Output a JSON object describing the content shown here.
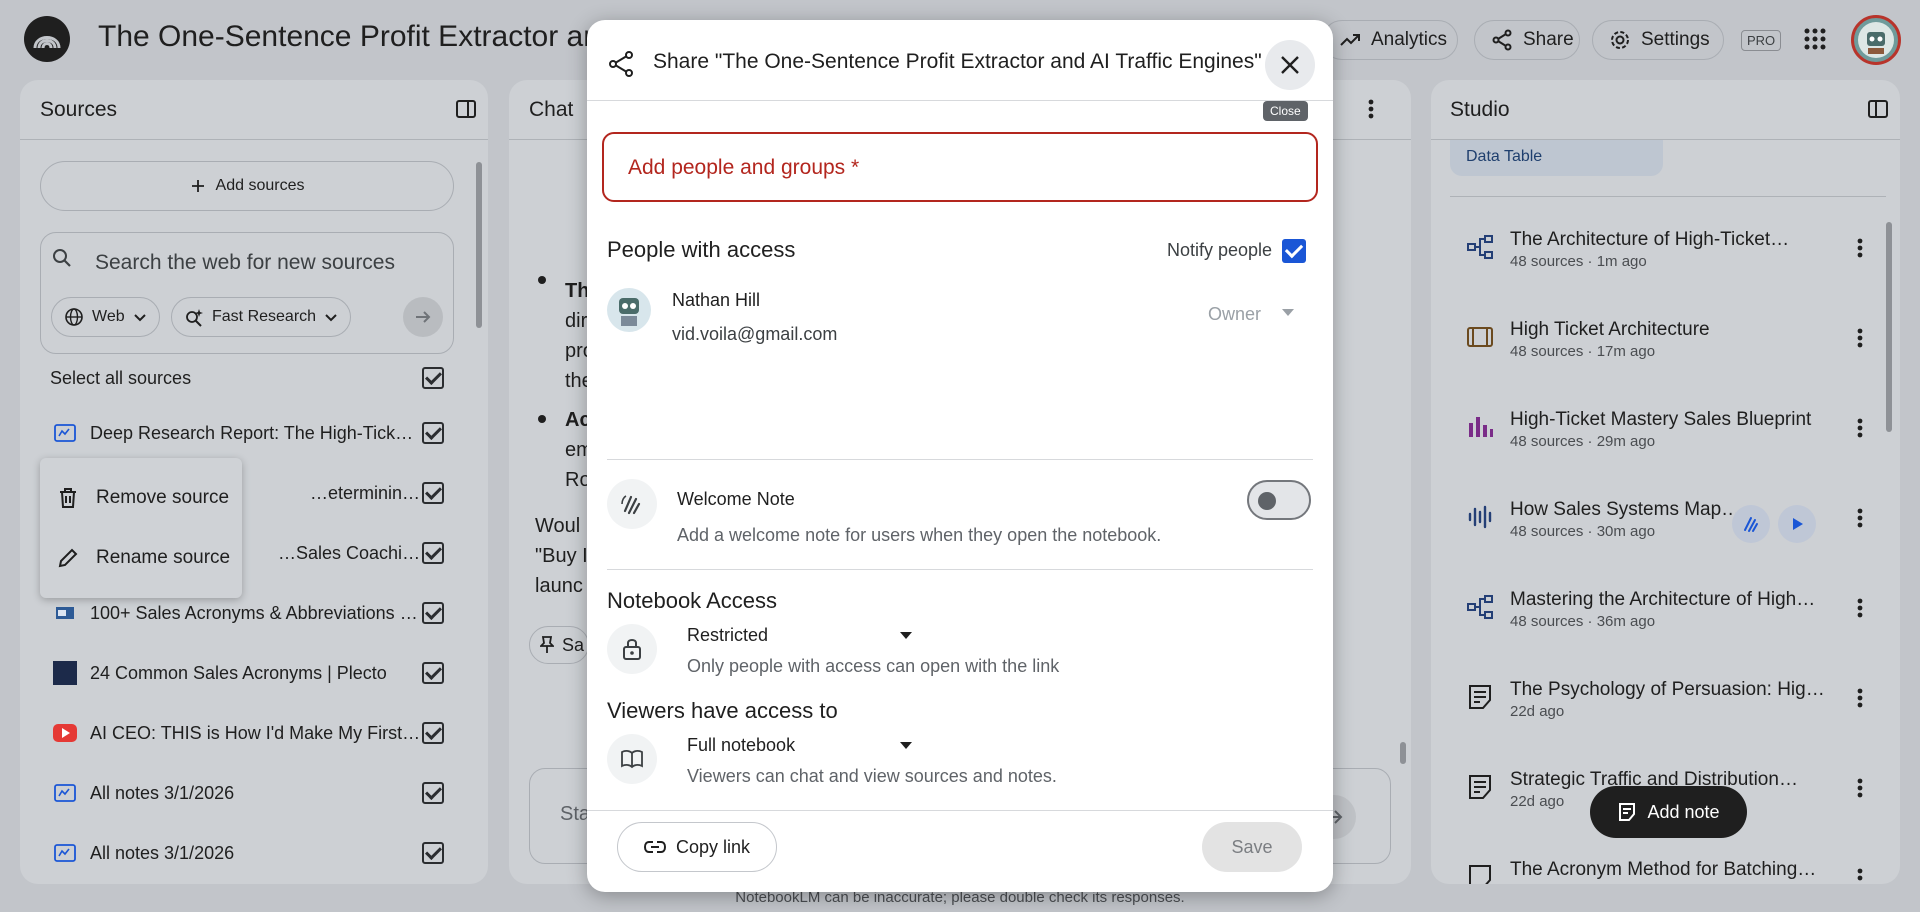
{
  "header": {
    "title": "The One-Sentence Profit Extractor and AI Traffic Engines",
    "analytics": "Analytics",
    "share": "Share",
    "settings": "Settings",
    "pro": "PRO"
  },
  "sources": {
    "title": "Sources",
    "add_sources": "Add sources",
    "search_placeholder": "Search the web for new sources",
    "web_chip": "Web",
    "research_chip": "Fast Research",
    "select_all": "Select all sources",
    "items": [
      {
        "label": "Deep Research Report: The High-Ticket Architecture",
        "icon": "report-icon"
      },
      {
        "label": "…etermining if this r…",
        "icon": "report-icon"
      },
      {
        "label": "…Sales Coaching - K…",
        "icon": "web-icon"
      },
      {
        "label": "100+ Sales Acronyms & Abbreviations to Know",
        "icon": "web-icon"
      },
      {
        "label": "24 Common Sales Acronyms | Plecto",
        "icon": "web-icon"
      },
      {
        "label": "AI CEO: THIS is How I'd Make My First Million",
        "icon": "youtube-icon"
      },
      {
        "label": "All notes 3/1/2026",
        "icon": "report-icon"
      },
      {
        "label": "All notes 3/1/2026",
        "icon": "report-icon"
      }
    ],
    "menu": {
      "remove": "Remove source",
      "rename": "Rename source"
    }
  },
  "chat": {
    "title": "Chat",
    "bullet1_fragments": [
      "Th",
      "dir",
      "pro",
      "the"
    ],
    "bullet2_fragments": [
      "Ac",
      "em",
      "Ro"
    ],
    "para_fragments": [
      "Woul",
      "\"Buy I",
      "launc"
    ],
    "save_note_fragment": "Sa",
    "input_fragment": "Sta"
  },
  "studio": {
    "title": "Studio",
    "data_table": "Data Table",
    "items": [
      {
        "title": "The Architecture of High-Ticket…",
        "sub": "48 sources · 1m ago",
        "icon": "mindmap-icon"
      },
      {
        "title": "High Ticket Architecture",
        "sub": "48 sources · 17m ago",
        "icon": "video-icon"
      },
      {
        "title": "High-Ticket Mastery Sales Blueprint",
        "sub": "48 sources · 29m ago",
        "icon": "infographic-icon"
      },
      {
        "title": "How Sales Systems Map…",
        "sub": "48 sources · 30m ago",
        "icon": "audio-icon"
      },
      {
        "title": "Mastering the Architecture of High…",
        "sub": "48 sources · 36m ago",
        "icon": "mindmap-icon"
      },
      {
        "title": "The Psychology of Persuasion: Hig…",
        "sub": "22d ago",
        "icon": "note-icon"
      },
      {
        "title": "Strategic Traffic and Distribution…",
        "sub": "22d ago",
        "icon": "note-icon"
      },
      {
        "title": "The Acronym Method for Batching…",
        "sub": "",
        "icon": "note-icon"
      }
    ],
    "add_note": "Add note"
  },
  "dialog": {
    "title": "Share \"The One-Sentence Profit Extractor and AI Traffic Engines\"",
    "close_tooltip": "Close",
    "add_people_placeholder": "Add people and groups *",
    "people_with_access": "People with access",
    "notify_people": "Notify people",
    "person": {
      "name": "Nathan Hill",
      "email": "vid.voila@gmail.com",
      "role": "Owner"
    },
    "welcome_note": {
      "title": "Welcome Note",
      "desc": "Add a welcome note for users when they open the notebook."
    },
    "notebook_access": {
      "heading": "Notebook Access",
      "value": "Restricted",
      "desc": "Only people with access can open with the link"
    },
    "viewers_access": {
      "heading": "Viewers have access to",
      "value": "Full notebook",
      "desc": "Viewers can chat and view sources and notes."
    },
    "copy_link": "Copy link",
    "save": "Save"
  },
  "footer": "NotebookLM can be inaccurate; please double check its responses."
}
